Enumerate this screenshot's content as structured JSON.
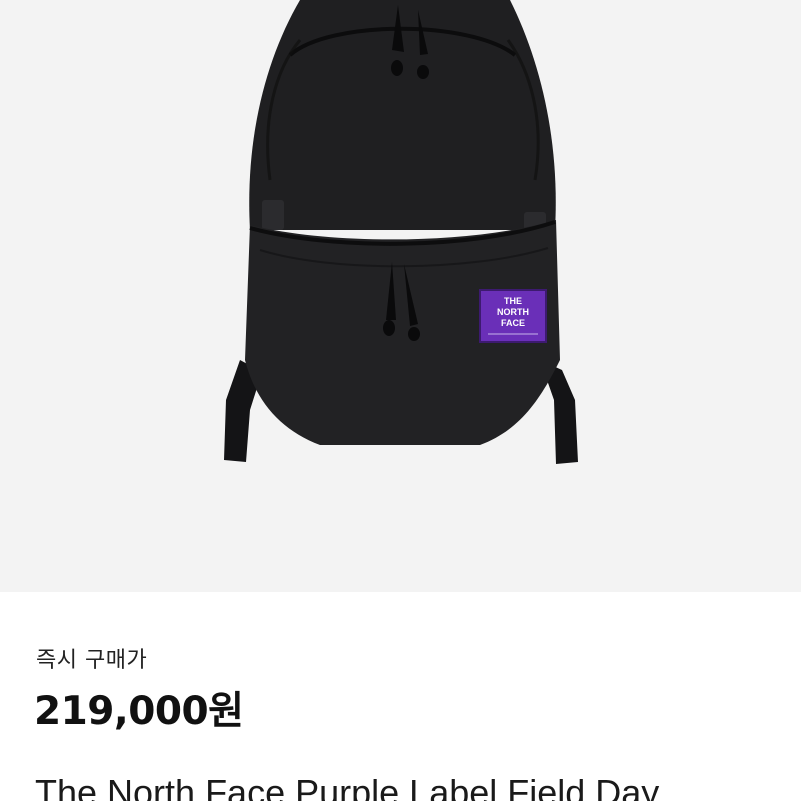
{
  "product": {
    "image_label": "backpack product photo",
    "logo_text_line1": "THE",
    "logo_text_line2": "NORTH",
    "logo_text_line3": "FACE",
    "price_label": "즉시 구매가",
    "price": "219,000원",
    "title": "The North Face Purple Label Field Day"
  },
  "colors": {
    "image_background": "#f3f3f3",
    "bag_body": "#1c1c1e",
    "label_purple": "#6a2fb8"
  }
}
